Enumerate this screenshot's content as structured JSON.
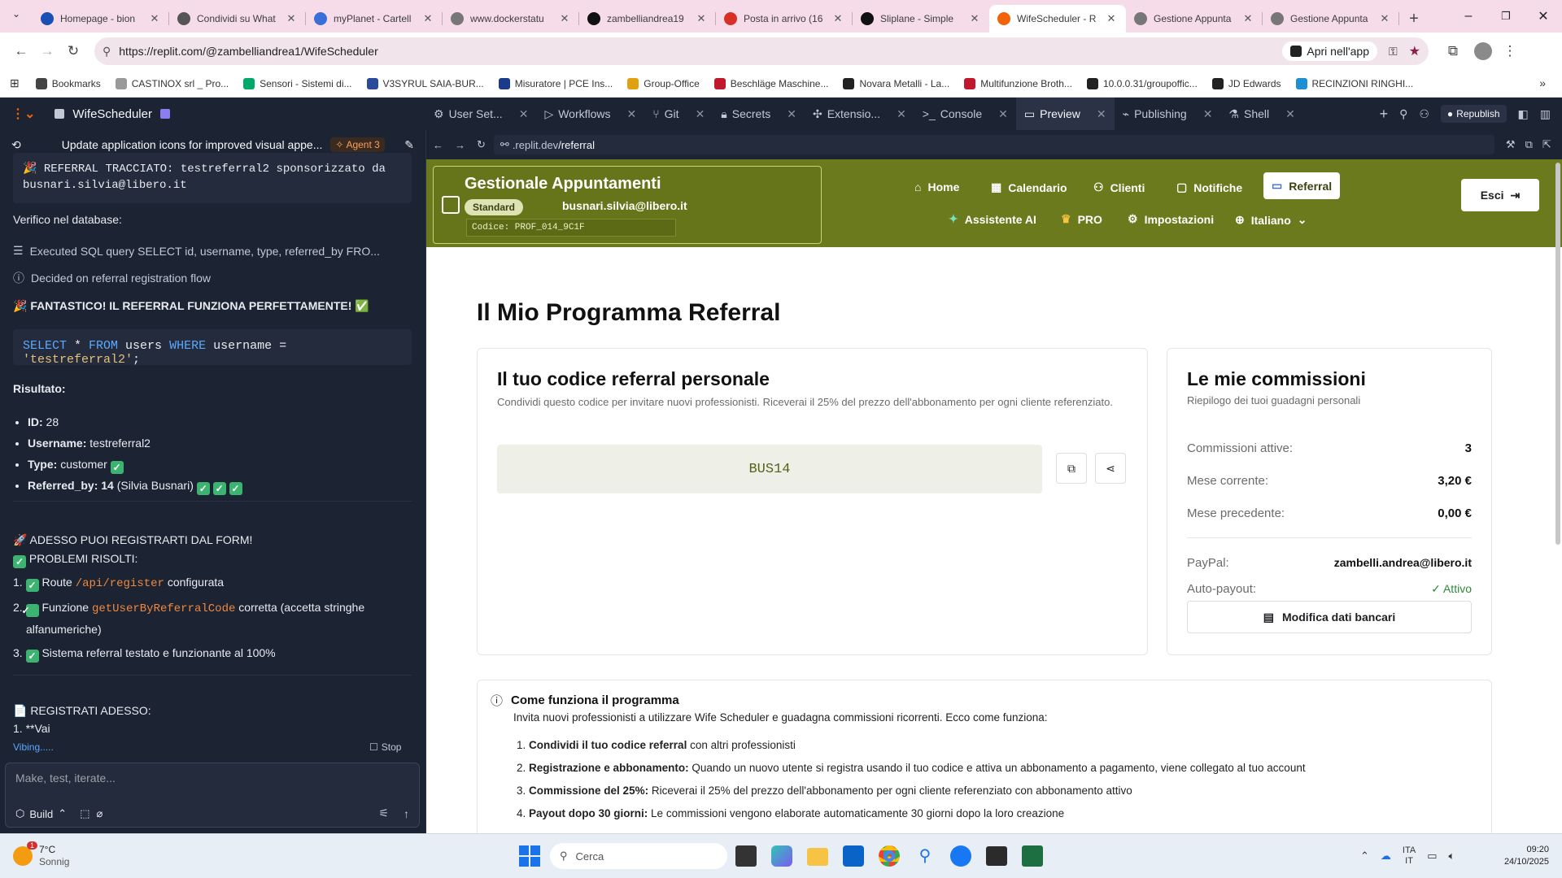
{
  "browser": {
    "tabs": [
      {
        "title": "Homepage - bion",
        "color": "#1a4fb3"
      },
      {
        "title": "Condividi su What",
        "color": "#555"
      },
      {
        "title": "myPlanet - Cartell",
        "color": "#3b6fd8"
      },
      {
        "title": "www.dockerstatu",
        "color": "#777"
      },
      {
        "title": "zambelliandrea19",
        "color": "#111"
      },
      {
        "title": "Posta in arrivo (16",
        "color": "#d93025"
      },
      {
        "title": "Sliplane - Simple",
        "color": "#111"
      },
      {
        "title": "WifeScheduler - R",
        "color": "#f26207"
      },
      {
        "title": "Gestione Appunta",
        "color": "#777"
      },
      {
        "title": "Gestione Appunta",
        "color": "#777"
      }
    ],
    "url": "https://replit.com/@zambelliandrea1/WifeScheduler",
    "open_in_app": "Apri nell'app",
    "bookmarks": [
      {
        "label": "Bookmarks",
        "color": "#444"
      },
      {
        "label": "CASTINOX srl _ Pro...",
        "color": "#999"
      },
      {
        "label": "Sensori - Sistemi di...",
        "color": "#00a86b"
      },
      {
        "label": "V3SYRUL SAIA-BUR...",
        "color": "#2a4a9a"
      },
      {
        "label": "Misuratore | PCE Ins...",
        "color": "#1a3a8a"
      },
      {
        "label": "Group-Office",
        "color": "#e0a010"
      },
      {
        "label": "Beschläge Maschine...",
        "color": "#c0182c"
      },
      {
        "label": "Novara Metalli - La...",
        "color": "#222"
      },
      {
        "label": "Multifunzione Broth...",
        "color": "#c0182c"
      },
      {
        "label": "10.0.0.31/groupoffic...",
        "color": "#222"
      },
      {
        "label": "JD Edwards",
        "color": "#222"
      },
      {
        "label": "RECINZIONI RINGHI...",
        "color": "#1e8fd0"
      }
    ]
  },
  "replit": {
    "project": "WifeScheduler",
    "tabs": [
      {
        "label": "User Set..."
      },
      {
        "label": "Workflows"
      },
      {
        "label": "Git"
      },
      {
        "label": "Secrets"
      },
      {
        "label": "Extensio..."
      },
      {
        "label": "Console"
      },
      {
        "label": "Preview"
      },
      {
        "label": "Publishing"
      },
      {
        "label": "Shell"
      }
    ],
    "republish": "Republish",
    "chat": {
      "title": "Update application icons for improved visual appe...",
      "agent": "Agent 3",
      "top_code": "🎉 REFERRAL TRACCIATO: testreferral2 sponsorizzato da busnari.silvia@libero.it",
      "verifico": "Verifico nel database:",
      "sql_step": "Executed SQL query SELECT id, username, type, referred_by FRO...",
      "decided": "Decided on referral registration flow",
      "fantastico": "🎉 FANTASTICO! IL REFERRAL FUNZIONA PERFETTAMENTE! ✅",
      "sql": {
        "k1": "SELECT",
        "star": " * ",
        "k2": "FROM",
        "t": " users ",
        "k3": "WHERE",
        "c": " username = ",
        "s": "'testreferral2'",
        "end": ";"
      },
      "risultato": "Risultato:",
      "r_id_k": "ID:",
      "r_id_v": " 28",
      "r_user_k": "Username:",
      "r_user_v": " testreferral2",
      "r_type_k": "Type:",
      "r_type_v": " customer",
      "r_ref_k": "Referred_by: 14",
      "r_ref_v": " (Silvia Busnari)",
      "adesso": "🚀 ADESSO PUOI REGISTRARTI DAL FORM!",
      "problemi": "PROBLEMI RISOLTI:",
      "p1a": "Route ",
      "p1c": "/api/register",
      "p1b": " configurata",
      "p2a": "Funzione ",
      "p2c": "getUserByReferralCode",
      "p2b": " corretta (accetta stringhe alfanumeriche)",
      "p3": "Sistema referral testato e funzionante al 100%",
      "registrati": "📄 REGISTRATI ADESSO:",
      "vai": "1. **Vai",
      "vibing": "Vibing.....",
      "stop": "Stop",
      "input_placeholder": "Make, test, iterate...",
      "build": "Build"
    }
  },
  "preview": {
    "url_prefix": ".replit.dev",
    "url_path": "/referral",
    "app": {
      "title": "Gestionale Appuntamenti",
      "badge": "Standard",
      "email": "busnari.silvia@libero.it",
      "codice": "Codice: PROF_014_9C1F",
      "nav": {
        "home": "Home",
        "calendario": "Calendario",
        "clienti": "Clienti",
        "notifiche": "Notifiche",
        "referral": "Referral",
        "assistente": "Assistente AI",
        "pro": "PRO",
        "impostazioni": "Impostazioni",
        "lang": "Italiano"
      },
      "esci": "Esci"
    },
    "page_title": "Il Mio Programma Referral",
    "code_card": {
      "title": "Il tuo codice referral personale",
      "desc": "Condividi questo codice per invitare nuovi professionisti. Riceverai il 25% del prezzo dell'abbonamento per ogni cliente referenziato.",
      "code": "BUS14"
    },
    "comm_card": {
      "title": "Le mie commissioni",
      "subtitle": "Riepilogo dei tuoi guadagni personali",
      "attive_label": "Commissioni attive:",
      "attive_value": "3",
      "corrente_label": "Mese corrente:",
      "corrente_value": "3,20 €",
      "precedente_label": "Mese precedente:",
      "precedente_value": "0,00 €",
      "paypal_label": "PayPal:",
      "paypal_value": "zambelli.andrea@libero.it",
      "payout_label": "Auto-payout:",
      "payout_value": "✓ Attivo",
      "button": "Modifica dati bancari"
    },
    "how": {
      "title": "Come funziona il programma",
      "intro": "Invita nuovi professionisti a utilizzare Wife Scheduler e guadagna commissioni ricorrenti. Ecco come funziona:",
      "steps": [
        {
          "n": "1.",
          "b": "Condividi il tuo codice referral",
          "t": " con altri professionisti"
        },
        {
          "n": "2.",
          "b": "Registrazione e abbonamento:",
          "t": " Quando un nuovo utente si registra usando il tuo codice e attiva un abbonamento a pagamento, viene collegato al tuo account"
        },
        {
          "n": "3.",
          "b": "Commissione del 25%:",
          "t": " Riceverai il 25% del prezzo dell'abbonamento per ogni cliente referenziato con abbonamento attivo"
        },
        {
          "n": "4.",
          "b": "Payout dopo 30 giorni:",
          "t": " Le commissioni vengono elaborate automaticamente 30 giorni dopo la loro creazione"
        }
      ]
    }
  },
  "taskbar": {
    "weather_temp": "7°C",
    "weather_desc": "Sonnig",
    "weather_badge": "1",
    "search": "Cerca",
    "lang1": "ITA",
    "lang2": "IT",
    "time": "09:20",
    "date": "24/10/2025"
  }
}
